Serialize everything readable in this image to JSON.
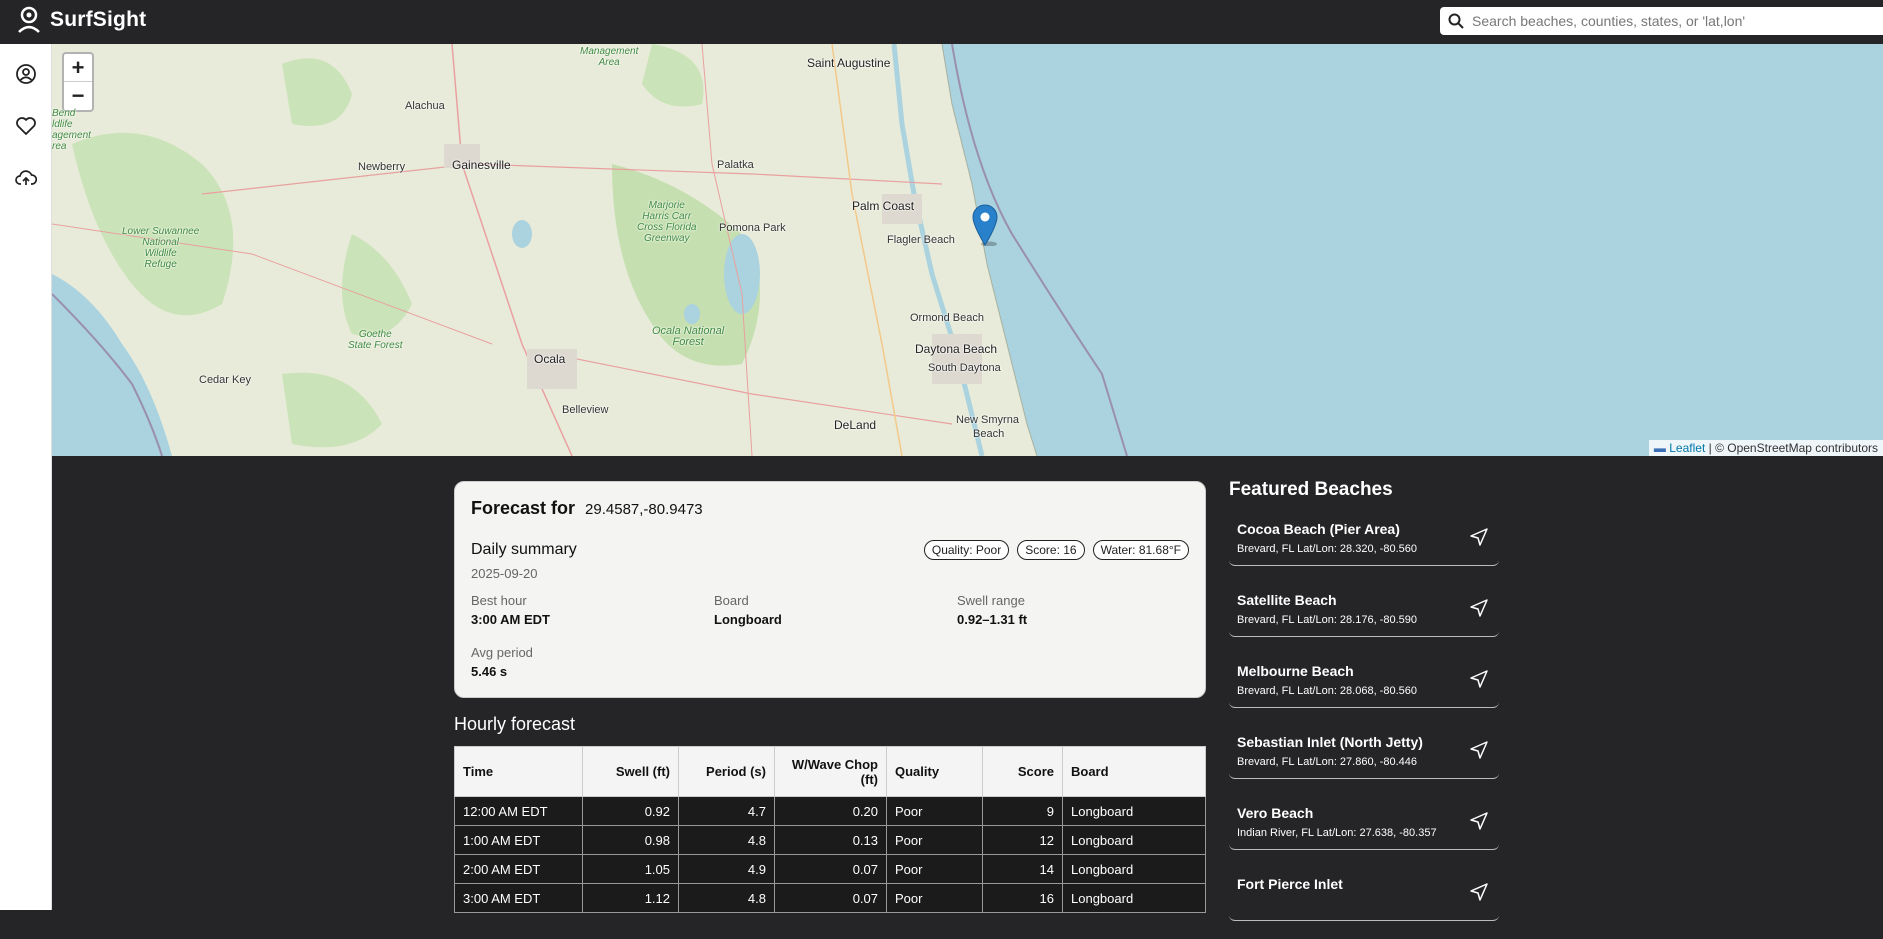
{
  "app": {
    "title": "SurfSight"
  },
  "search": {
    "placeholder": "Search beaches, counties, states, or 'lat,lon'"
  },
  "sidebar": {
    "items": [
      "profile-icon",
      "favorites-icon",
      "upload-icon"
    ]
  },
  "map": {
    "zoom_in": "+",
    "zoom_out": "−",
    "attribution_link": "Leaflet",
    "attribution_text": "| © OpenStreetMap contributors",
    "labels": {
      "saint_augustine": "Saint Augustine",
      "alachua": "Alachua",
      "gainesville": "Gainesville",
      "newberry": "Newberry",
      "palatka": "Palatka",
      "palm_coast": "Palm Coast",
      "flagler_beach": "Flagler Beach",
      "pomona_park": "Pomona Park",
      "ormond_beach": "Ormond Beach",
      "daytona_beach": "Daytona Beach",
      "south_daytona": "South Daytona",
      "ocala": "Ocala",
      "belleview": "Belleview",
      "deland": "DeLand",
      "new_smyrna": "New Smyrna",
      "beach": "Beach",
      "cedar_key": "Cedar Key",
      "lower_suwannee": "Lower Suwannee\nNational\nWildlife\nRefuge",
      "marjorie": "Marjorie\nHarris Carr\nCross Florida\nGreenway",
      "ocala_nf": "Ocala National\nForest",
      "goethe": "Goethe\nState Forest",
      "management": "Management\nArea",
      "bend": "Bend\nldlife\nagement\nrea"
    }
  },
  "forecast": {
    "title": "Forecast for",
    "coords": "29.4587,-80.9473",
    "summary_title": "Daily summary",
    "date": "2025-09-20",
    "pills": [
      "Quality: Poor",
      "Score: 16",
      "Water: 81.68°F"
    ],
    "best_hour_label": "Best hour",
    "best_hour": "3:00 AM EDT",
    "board_label": "Board",
    "board": "Longboard",
    "swell_label": "Swell range",
    "swell": "0.92–1.31 ft",
    "period_label": "Avg period",
    "period": "5.46 s"
  },
  "hourly": {
    "title": "Hourly forecast",
    "headers": [
      "Time",
      "Swell (ft)",
      "Period (s)",
      "W/Wave Chop (ft)",
      "Quality",
      "Score",
      "Board"
    ],
    "rows": [
      [
        "12:00 AM EDT",
        "0.92",
        "4.7",
        "0.20",
        "Poor",
        "9",
        "Longboard"
      ],
      [
        "1:00 AM EDT",
        "0.98",
        "4.8",
        "0.13",
        "Poor",
        "12",
        "Longboard"
      ],
      [
        "2:00 AM EDT",
        "1.05",
        "4.9",
        "0.07",
        "Poor",
        "14",
        "Longboard"
      ],
      [
        "3:00 AM EDT",
        "1.12",
        "4.8",
        "0.07",
        "Poor",
        "16",
        "Longboard"
      ]
    ]
  },
  "featured": {
    "title": "Featured Beaches",
    "beaches": [
      {
        "name": "Cocoa Beach (Pier Area)",
        "meta": "Brevard, FL   Lat/Lon: 28.320, -80.560"
      },
      {
        "name": "Satellite Beach",
        "meta": "Brevard, FL   Lat/Lon: 28.176, -80.590"
      },
      {
        "name": "Melbourne Beach",
        "meta": "Brevard, FL   Lat/Lon: 28.068, -80.560"
      },
      {
        "name": "Sebastian Inlet (North Jetty)",
        "meta": "Brevard, FL   Lat/Lon: 27.860, -80.446"
      },
      {
        "name": "Vero Beach",
        "meta": "Indian River, FL   Lat/Lon: 27.638, -80.357"
      },
      {
        "name": "Fort Pierce Inlet",
        "meta": ""
      }
    ]
  },
  "colors": {
    "background": "#252527",
    "ocean": "#aad3df",
    "land": "#e6ead8",
    "forest": "#c8e0b4",
    "marker": "#2a81cb"
  }
}
